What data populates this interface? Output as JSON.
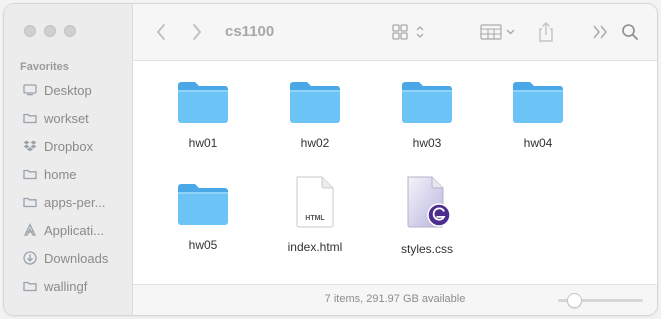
{
  "window": {
    "title": "cs1100"
  },
  "sidebar": {
    "section_title": "Favorites",
    "items": [
      {
        "label": "Desktop",
        "icon": "desktop-icon"
      },
      {
        "label": "workset",
        "icon": "folder-icon"
      },
      {
        "label": "Dropbox",
        "icon": "dropbox-icon"
      },
      {
        "label": "home",
        "icon": "home-icon"
      },
      {
        "label": "apps-per...",
        "icon": "folder-icon"
      },
      {
        "label": "Applicati...",
        "icon": "applications-icon"
      },
      {
        "label": "Downloads",
        "icon": "downloads-icon"
      },
      {
        "label": "wallingf",
        "icon": "person-icon"
      }
    ]
  },
  "toolbar": {
    "back": "chevron-left-icon",
    "forward": "chevron-right-icon",
    "view": "icon-grid-view-icon",
    "group": "group-by-icon",
    "share": "share-icon",
    "more": "double-chevron-right-icon",
    "search": "search-icon"
  },
  "files": [
    {
      "name": "hw01",
      "kind": "folder"
    },
    {
      "name": "hw02",
      "kind": "folder"
    },
    {
      "name": "hw03",
      "kind": "folder"
    },
    {
      "name": "hw04",
      "kind": "folder"
    },
    {
      "name": "hw05",
      "kind": "folder"
    },
    {
      "name": "index.html",
      "kind": "html",
      "badge": "HTML"
    },
    {
      "name": "styles.css",
      "kind": "css"
    }
  ],
  "status": {
    "text": "7 items, 291.97 GB available",
    "zoom_level": 0.18
  },
  "colors": {
    "folder": "#6cc3f5",
    "folder_tab": "#4aa8e8",
    "sidebar_bg": "#ececec"
  }
}
